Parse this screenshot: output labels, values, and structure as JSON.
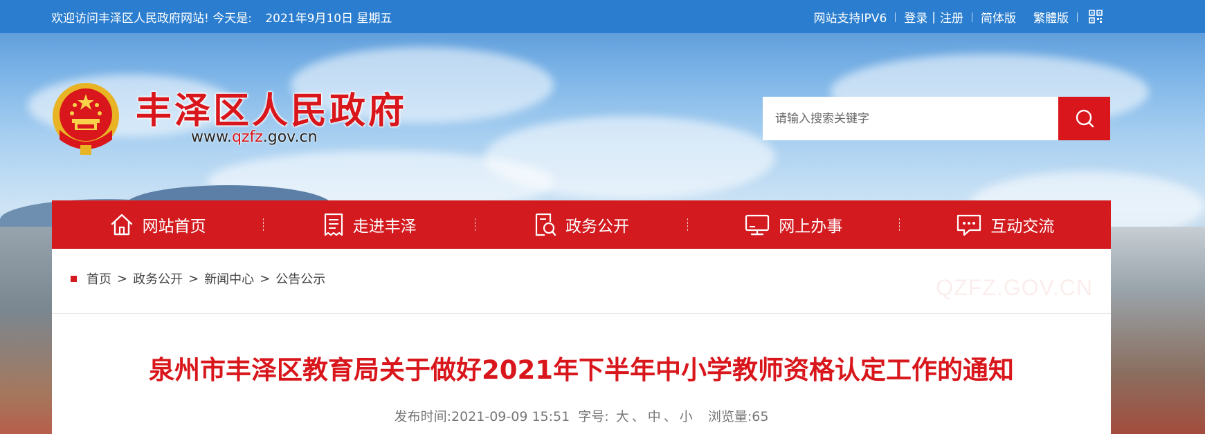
{
  "topbar": {
    "welcome": "欢迎访问丰泽区人民政府网站! 今天是:",
    "date": "2021年9月10日 星期五",
    "ipv6": "网站支持IPV6",
    "login": "登录",
    "divider": "|",
    "register": "注册",
    "simplified": "简体版",
    "traditional": "繁體版"
  },
  "header": {
    "title": "丰泽区人民政府",
    "url_prefix": "www.",
    "url_domain": "qzfz",
    "url_suffix": ".gov.cn"
  },
  "search": {
    "placeholder": "请输入搜索关键字"
  },
  "nav": {
    "items": [
      {
        "label": "网站首页",
        "icon": "home-icon"
      },
      {
        "label": "走进丰泽",
        "icon": "document-icon"
      },
      {
        "label": "政务公开",
        "icon": "search-doc-icon"
      },
      {
        "label": "网上办事",
        "icon": "monitor-icon"
      },
      {
        "label": "互动交流",
        "icon": "chat-icon"
      }
    ]
  },
  "breadcrumb": {
    "items": [
      "首页",
      "政务公开",
      "新闻中心",
      "公告公示"
    ],
    "separator": ">"
  },
  "watermark": "QZFZ.GOV.CN",
  "article": {
    "title": "泉州市丰泽区教育局关于做好2021年下半年中小学教师资格认定工作的通知",
    "published_label": "发布时间:",
    "published": "2021-09-09 15:51",
    "font_label": "字号:",
    "font_large": "大",
    "font_medium": "中",
    "font_small": "小",
    "font_sep": "、",
    "views_label": "浏览量:",
    "views": "65"
  },
  "colors": {
    "topbar": "#2b7ecf",
    "accent_red": "#d8161b",
    "nav_red": "#d21a1f"
  }
}
